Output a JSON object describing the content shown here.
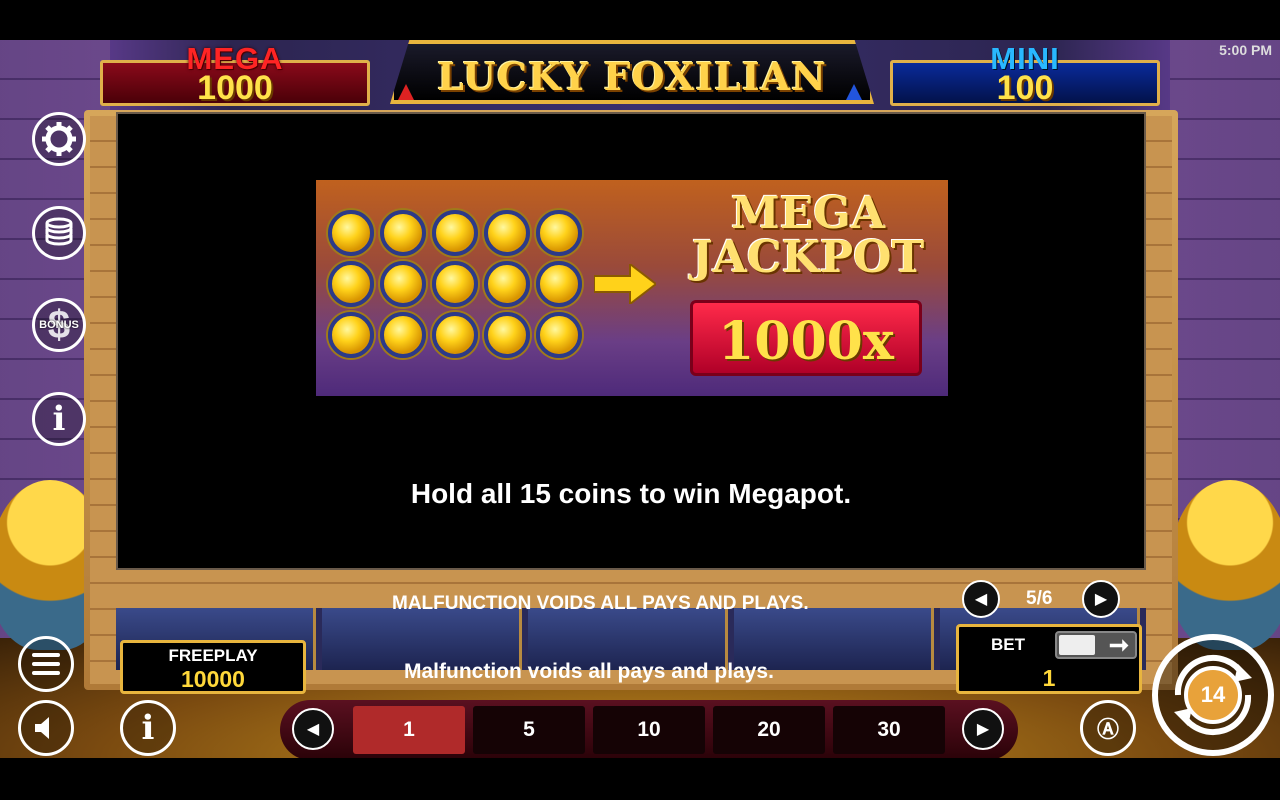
{
  "status_bar": {
    "time": "5:00 PM"
  },
  "game": {
    "title": "LUCKY FOXILIAN"
  },
  "jackpots": {
    "mega": {
      "label": "MEGA",
      "value": "1000"
    },
    "mini": {
      "label": "MINI",
      "value": "100"
    }
  },
  "side_menu": {
    "icons": [
      "gear-icon",
      "coin-stack-icon",
      "bonus-dollar-icon",
      "info-icon"
    ],
    "bonus_label": "BONUS"
  },
  "info_panel": {
    "banner": {
      "coin_count": 15,
      "mega_text_line1": "MEGA",
      "mega_text_line2": "JACKPOT",
      "multiplier": "1000x"
    },
    "description": "Hold all 15 coins to win Megapot.",
    "notice": "MALFUNCTION VOIDS ALL PAYS AND PLAYS.",
    "page": "5/6"
  },
  "bottom": {
    "freeplay_label": "FREEPLAY",
    "freeplay_value": "10000",
    "malfunction_text": "Malfunction voids all pays and plays.",
    "bet_label": "BET",
    "bet_value": "1",
    "bet_options": [
      "1",
      "5",
      "10",
      "20",
      "30"
    ],
    "selected_bet": "1",
    "spin_badge": "14"
  },
  "colors": {
    "accent_gold": "#e8b53e",
    "mega_red": "#ff2424",
    "mini_blue": "#29b8ff",
    "selected_bet": "#b02a2a"
  }
}
